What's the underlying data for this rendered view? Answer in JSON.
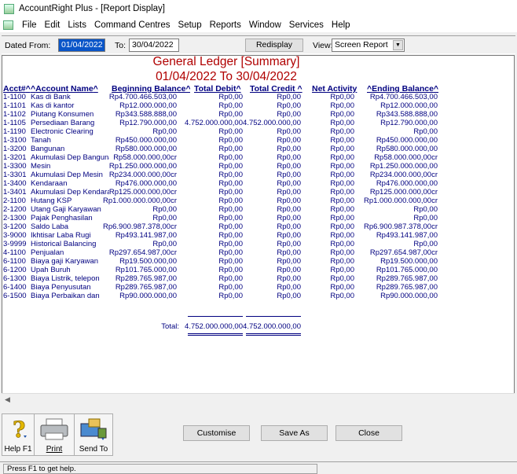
{
  "window": {
    "title": "AccountRight Plus - [Report Display]"
  },
  "menu": [
    "File",
    "Edit",
    "Lists",
    "Command Centres",
    "Setup",
    "Reports",
    "Window",
    "Services",
    "Help"
  ],
  "filter": {
    "dated_from_label": "Dated From:",
    "dated_from": "01/04/2022",
    "to_label": "To:",
    "to": "30/04/2022",
    "redisplay": "Redisplay",
    "view_label": "View:",
    "view": "Screen Report"
  },
  "report": {
    "title": "General Ledger [Summary]",
    "subtitle": "01/04/2022 To 30/04/2022",
    "headers": {
      "acct": "Acct#",
      "name": "Account Name",
      "begin": "Beginning Balance",
      "debit": "Total Debit",
      "credit": "Total Credit",
      "net": "Net Activity",
      "end": "Ending Balance"
    },
    "rows": [
      {
        "acct": "1-1100",
        "name": "Kas di Bank",
        "begin": "Rp4.700.466.503,00",
        "debit": "Rp0,00",
        "credit": "Rp0,00",
        "net": "Rp0,00",
        "end": "Rp4.700.466.503,00"
      },
      {
        "acct": "1-1101",
        "name": "Kas di kantor",
        "begin": "Rp12.000.000,00",
        "debit": "Rp0,00",
        "credit": "Rp0,00",
        "net": "Rp0,00",
        "end": "Rp12.000.000,00"
      },
      {
        "acct": "1-1102",
        "name": "Piutang Konsumen",
        "begin": "Rp343.588.888,00",
        "debit": "Rp0,00",
        "credit": "Rp0,00",
        "net": "Rp0,00",
        "end": "Rp343.588.888,00"
      },
      {
        "acct": "1-1105",
        "name": "Persediaan Barang",
        "begin": "Rp12.790.000,00",
        "debit": "4.752.000.000,00",
        "credit": "4.752.000.000,00",
        "net": "Rp0,00",
        "end": "Rp12.790.000,00"
      },
      {
        "acct": "1-1190",
        "name": "Electronic Clearing",
        "begin": "Rp0,00",
        "debit": "Rp0,00",
        "credit": "Rp0,00",
        "net": "Rp0,00",
        "end": "Rp0,00"
      },
      {
        "acct": "1-3100",
        "name": "Tanah",
        "begin": "Rp450.000.000,00",
        "debit": "Rp0,00",
        "credit": "Rp0,00",
        "net": "Rp0,00",
        "end": "Rp450.000.000,00"
      },
      {
        "acct": "1-3200",
        "name": "Bangunan",
        "begin": "Rp580.000.000,00",
        "debit": "Rp0,00",
        "credit": "Rp0,00",
        "net": "Rp0,00",
        "end": "Rp580.000.000,00"
      },
      {
        "acct": "1-3201",
        "name": "Akumulasi Dep Bangunan",
        "begin": "Rp58.000.000,00cr",
        "debit": "Rp0,00",
        "credit": "Rp0,00",
        "net": "Rp0,00",
        "end": "Rp58.000.000,00cr"
      },
      {
        "acct": "1-3300",
        "name": "Mesin",
        "begin": "Rp1.250.000.000,00",
        "debit": "Rp0,00",
        "credit": "Rp0,00",
        "net": "Rp0,00",
        "end": "Rp1.250.000.000,00"
      },
      {
        "acct": "1-3301",
        "name": "Akumulasi Dep Mesin",
        "begin": "Rp234.000.000,00cr",
        "debit": "Rp0,00",
        "credit": "Rp0,00",
        "net": "Rp0,00",
        "end": "Rp234.000.000,00cr"
      },
      {
        "acct": "1-3400",
        "name": "Kendaraan",
        "begin": "Rp476.000.000,00",
        "debit": "Rp0,00",
        "credit": "Rp0,00",
        "net": "Rp0,00",
        "end": "Rp476.000.000,00"
      },
      {
        "acct": "1-3401",
        "name": "Akumulasi Dep Kendaraan",
        "begin": "Rp125.000.000,00cr",
        "debit": "Rp0,00",
        "credit": "Rp0,00",
        "net": "Rp0,00",
        "end": "Rp125.000.000,00cr"
      },
      {
        "acct": "2-1100",
        "name": "Hutang KSP",
        "begin": "Rp1.000.000.000,00cr",
        "debit": "Rp0,00",
        "credit": "Rp0,00",
        "net": "Rp0,00",
        "end": "Rp1.000.000.000,00cr"
      },
      {
        "acct": "2-1200",
        "name": "Utang Gaji Karyawan",
        "begin": "Rp0,00",
        "debit": "Rp0,00",
        "credit": "Rp0,00",
        "net": "Rp0,00",
        "end": "Rp0,00"
      },
      {
        "acct": "2-1300",
        "name": "Pajak Penghasilan",
        "begin": "Rp0,00",
        "debit": "Rp0,00",
        "credit": "Rp0,00",
        "net": "Rp0,00",
        "end": "Rp0,00"
      },
      {
        "acct": "3-1200",
        "name": "Saldo Laba",
        "begin": "Rp6.900.987.378,00cr",
        "debit": "Rp0,00",
        "credit": "Rp0,00",
        "net": "Rp0,00",
        "end": "Rp6.900.987.378,00cr"
      },
      {
        "acct": "3-9000",
        "name": "Ikhtisar Laba Rugi",
        "begin": "Rp493.141.987,00",
        "debit": "Rp0,00",
        "credit": "Rp0,00",
        "net": "Rp0,00",
        "end": "Rp493.141.987,00"
      },
      {
        "acct": "3-9999",
        "name": "Historical Balancing",
        "begin": "Rp0,00",
        "debit": "Rp0,00",
        "credit": "Rp0,00",
        "net": "Rp0,00",
        "end": "Rp0,00"
      },
      {
        "acct": "4-1100",
        "name": "Penjualan",
        "begin": "Rp297.654.987,00cr",
        "debit": "Rp0,00",
        "credit": "Rp0,00",
        "net": "Rp0,00",
        "end": "Rp297.654.987,00cr"
      },
      {
        "acct": "6-1100",
        "name": "Biaya gaji Karyawan",
        "begin": "Rp19.500.000,00",
        "debit": "Rp0,00",
        "credit": "Rp0,00",
        "net": "Rp0,00",
        "end": "Rp19.500.000,00"
      },
      {
        "acct": "6-1200",
        "name": "Upah Buruh",
        "begin": "Rp101.765.000,00",
        "debit": "Rp0,00",
        "credit": "Rp0,00",
        "net": "Rp0,00",
        "end": "Rp101.765.000,00"
      },
      {
        "acct": "6-1300",
        "name": "Biaya Listrik, telepon",
        "begin": "Rp289.765.987,00",
        "debit": "Rp0,00",
        "credit": "Rp0,00",
        "net": "Rp0,00",
        "end": "Rp289.765.987,00"
      },
      {
        "acct": "6-1400",
        "name": "Biaya Penyusutan",
        "begin": "Rp289.765.987,00",
        "debit": "Rp0,00",
        "credit": "Rp0,00",
        "net": "Rp0,00",
        "end": "Rp289.765.987,00"
      },
      {
        "acct": "6-1500",
        "name": "Biaya Perbaikan dan",
        "begin": "Rp90.000.000,00",
        "debit": "Rp0,00",
        "credit": "Rp0,00",
        "net": "Rp0,00",
        "end": "Rp90.000.000,00"
      }
    ],
    "total_label": "Total:",
    "total_debit": "4.752.000.000,00",
    "total_credit": "4.752.000.000,00"
  },
  "buttons": {
    "help": "Help F1",
    "print": "Print",
    "send_to": "Send To",
    "customise": "Customise",
    "save_as": "Save As",
    "close": "Close"
  },
  "status": "Press F1 to get help."
}
